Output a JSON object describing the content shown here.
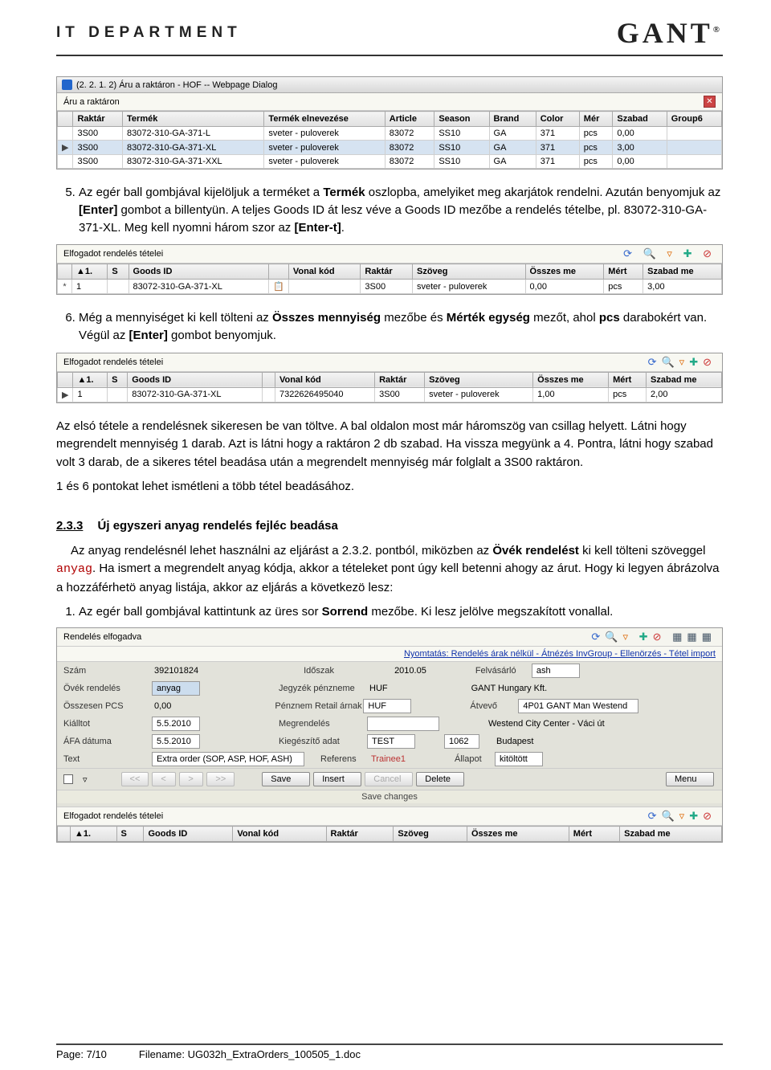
{
  "header": {
    "dept": "IT DEPARTMENT",
    "brand": "GANT"
  },
  "dialog1": {
    "title": "(2. 2. 1. 2) Áru a raktáron - HOF -- Webpage Dialog",
    "sub": "Áru a raktáron",
    "cols": [
      "",
      "Raktár",
      "Termék",
      "Termék elnevezése",
      "Article",
      "Season",
      "Brand",
      "Color",
      "Mér",
      "Szabad",
      "Group6"
    ],
    "rows": [
      [
        "",
        "3S00",
        "83072-310-GA-371-L",
        "sveter - puloverek",
        "83072",
        "SS10",
        "GA",
        "371",
        "pcs",
        "0,00",
        ""
      ],
      [
        "▶",
        "3S00",
        "83072-310-GA-371-XL",
        "sveter - puloverek",
        "83072",
        "SS10",
        "GA",
        "371",
        "pcs",
        "3,00",
        ""
      ],
      [
        "",
        "3S00",
        "83072-310-GA-371-XXL",
        "sveter - puloverek",
        "83072",
        "SS10",
        "GA",
        "371",
        "pcs",
        "0,00",
        ""
      ]
    ]
  },
  "text": {
    "li5": "Az egér ball gombjával kijelöljuk a terméket a <b>Termék</b> oszlopba, amelyiket meg akarjátok rendelni. Azután benyomjuk az <b>[Enter]</b> gombot a billentyün. A teljes Goods ID át lesz véve a Goods ID mezőbe a rendelés tételbe, pl. 83072-310-GA-371-XL. Meg kell nyomni három szor az <b>[Enter-t]</b>.",
    "li6": "Még a mennyiséget ki kell tölteni az <b>Összes mennyiség</b> mezőbe és <b>Mérték egység</b> mezőt, ahol <b>pcs</b> darabokért van. Végül az <b>[Enter]</b> gombot benyomjuk.",
    "p1": "Az elsó tétele a rendelésnek sikeresen be van töltve. A bal oldalon most már háromszög van csillag helyett. Látni hogy megrendelt mennyiség 1 darab. Azt is látni hogy a raktáron 2 db szabad. Ha vissza megyünk a 4. Pontra, látni hogy szabad volt 3 darab, de a sikeres tétel beadása után a megrendelt mennyiség már folglalt a 3S00 raktáron.",
    "p2": "1 és 6 pontokat lehet ismétleni a több tétel beadásához.",
    "sec_num": "2.3.3",
    "sec_title": "Új egyszeri anyag rendelés fejléc beadása",
    "p3": "Az anyag rendelésnél lehet használni az eljárást a 2.3.2. pontból, miközben az <b>Övék rendelést</b> ki kell tölteni szöveggel <span class='mono'>anyag</span>. Ha ismert a megrendelt anyag kódja, akkor a tételeket pont úgy kell betenni ahogy az árut. Hogy ki legyen ábrázolva a hozzáférhetö anyag listája, akkor az eljárás a következö lesz:",
    "li1b": "Az egér ball gombjával kattintunk az üres sor <b>Sorrend</b> mezőbe. Ki lesz jelölve megszakított vonallal."
  },
  "panel2": {
    "title": "Elfogadot rendelés tételei",
    "cols": [
      "",
      "▲1.",
      "S",
      "Goods ID",
      "",
      "Vonal kód",
      "Raktár",
      "Szöveg",
      "Összes me",
      "Mért",
      "Szabad me"
    ],
    "rowA": [
      "*",
      "1",
      "",
      "83072-310-GA-371-XL",
      "📋",
      "",
      "3S00",
      "sveter - puloverek",
      "0,00",
      "pcs",
      "3,00"
    ],
    "rowB": [
      "▶",
      "1",
      "",
      "83072-310-GA-371-XL",
      "",
      "7322626495040",
      "3S00",
      "sveter - puloverek",
      "1,00",
      "pcs",
      "2,00"
    ]
  },
  "form": {
    "title": "Rendelés elfogadva",
    "toolbar_links": "Nyomtatás: Rendelés árak nélkül - Átnézés InvGroup - Ellenörzés - Tétel import",
    "rows": {
      "szam": [
        "Szám",
        "392101824"
      ],
      "idoszak": [
        "Időszak",
        "2010.05"
      ],
      "felvas": [
        "Felvásárló",
        "ash"
      ],
      "ovek": [
        "Övék rendelés",
        "anyag"
      ],
      "jegyzek": [
        "Jegyzék pénzneme",
        "HUF"
      ],
      "gant": "GANT Hungary Kft.",
      "ossz": [
        "Összesen PCS",
        "0,00"
      ],
      "penznem": [
        "Pénznem Retail árnak",
        "HUF"
      ],
      "atvevo": [
        "Átvevő",
        "4P01 GANT Man Westend"
      ],
      "kiall": [
        "Kiálltot",
        "5.5.2010"
      ],
      "megrend": [
        "Megrendelés",
        ""
      ],
      "westend": "Westend City Center - Váci út",
      "afa": [
        "ÁFA dátuma",
        "5.5.2010"
      ],
      "kieg": [
        "Kiegészítő adat",
        "TEST"
      ],
      "zip": "1062",
      "city": "Budapest",
      "text": [
        "Text",
        "Extra order (SOP, ASP, HOF, ASH)"
      ],
      "referens": [
        "Referens",
        "Trainee1"
      ],
      "allapot": [
        "Állapot",
        "kitöltött"
      ]
    },
    "buttons": {
      "nav": [
        "<<",
        "<",
        ">",
        ">>"
      ],
      "save": "Save",
      "insert": "Insert",
      "cancel": "Cancel",
      "delete": "Delete",
      "menu": "Menu",
      "save_changes": "Save changes"
    }
  },
  "panel3": {
    "title": "Elfogadot rendelés tételei",
    "cols": [
      "",
      "▲1.",
      "S",
      "Goods ID",
      "Vonal kód",
      "Raktár",
      "Szöveg",
      "Összes me",
      "Mért",
      "Szabad me"
    ]
  },
  "footer": {
    "page": "Page: 7/10",
    "file": "Filename: UG032h_ExtraOrders_100505_1.doc"
  }
}
